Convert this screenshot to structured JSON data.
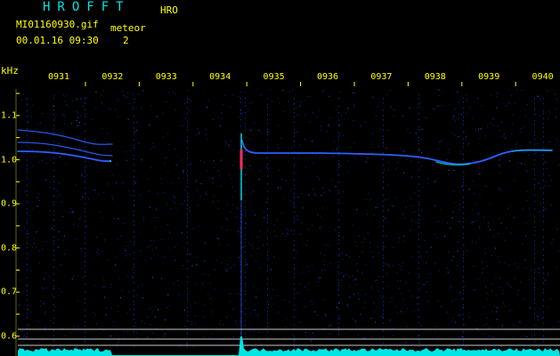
{
  "header": {
    "app_title": "HROFFT",
    "sub_title": "HRO",
    "file_name": "MI01160930.gif",
    "meteor_label": "meteor",
    "timestamp": "00.01.16 09:30",
    "meteor_count": "2",
    "unit_label": "kHz"
  },
  "time_axis": {
    "labels": [
      "0931",
      "0932",
      "0933",
      "0934",
      "0935",
      "0936",
      "0937",
      "0938",
      "0939",
      "0940"
    ]
  },
  "freq_axis": {
    "labels": [
      "1.1",
      "1.0",
      "0.9",
      "0.8",
      "0.7",
      "0.6"
    ]
  },
  "colors": {
    "background": "#000000",
    "text": "#ffff00",
    "title": "#00e5e5",
    "trace": "#2f5fff",
    "trace_bright": "#00e5e5",
    "meteor_head": "#ff2a6a",
    "noise_bar": "#00e5e5",
    "rule": "#c8c8c8"
  }
}
